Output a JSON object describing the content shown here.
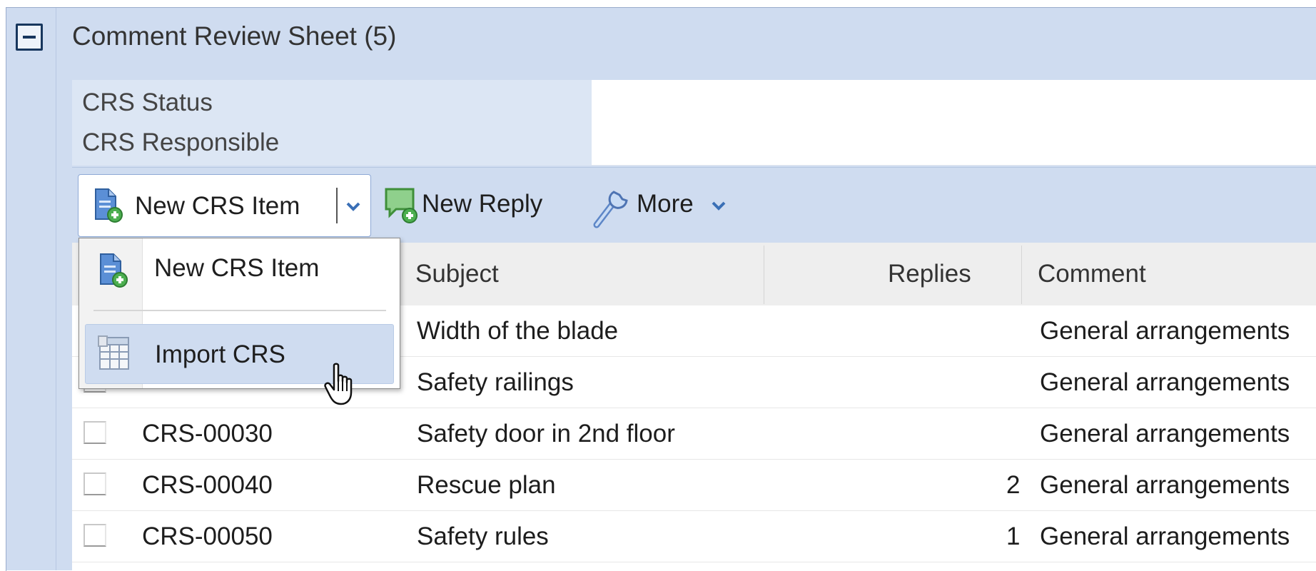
{
  "section": {
    "title": "Comment Review Sheet (5)",
    "collapse_icon": "minus-box-icon"
  },
  "fields": [
    {
      "label": "CRS Status",
      "value": ""
    },
    {
      "label": "CRS Responsible",
      "value": ""
    }
  ],
  "toolbar": {
    "new_crs_item_label": "New CRS Item",
    "new_reply_label": "New Reply",
    "more_label": "More"
  },
  "table": {
    "columns": [
      "Subject",
      "Replies",
      "Comment"
    ],
    "rows": [
      {
        "id": "",
        "subject": "Width of the blade",
        "replies": "",
        "comment": "General arrangements"
      },
      {
        "id": "",
        "subject": "Safety railings",
        "replies": "",
        "comment": "General arrangements"
      },
      {
        "id": "CRS-00030",
        "subject": "Safety door in 2nd floor",
        "replies": "",
        "comment": "General arrangements"
      },
      {
        "id": "CRS-00040",
        "subject": "Rescue plan",
        "replies": "2",
        "comment": "General arrangements"
      },
      {
        "id": "CRS-00050",
        "subject": "Safety rules",
        "replies": "1",
        "comment": "General arrangements"
      }
    ]
  },
  "dropdown_menu": {
    "items": [
      {
        "label": "New CRS Item",
        "icon": "document-add-icon"
      },
      {
        "label": "Import CRS",
        "icon": "spreadsheet-import-icon"
      }
    ]
  },
  "colors": {
    "panel": "#cfdcf0",
    "label_bg": "#dce6f4",
    "header_bg": "#eeeeee",
    "border": "#8ea9d6"
  }
}
